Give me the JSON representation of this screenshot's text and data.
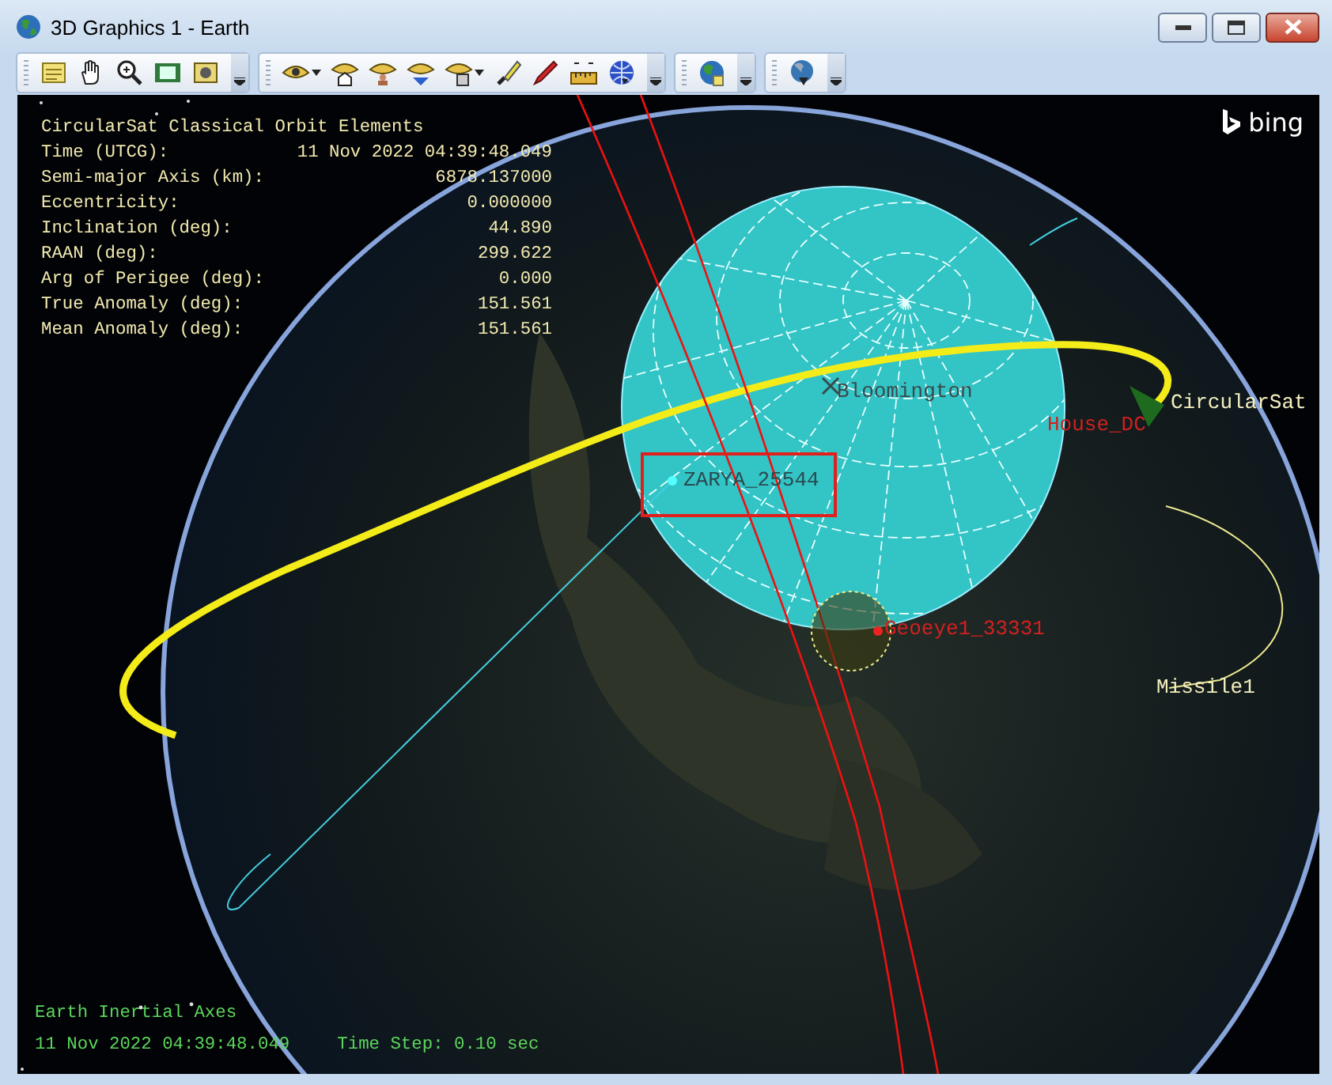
{
  "window": {
    "title": "3D Graphics 1 - Earth"
  },
  "orbit_elements": {
    "title": "CircularSat Classical Orbit Elements",
    "rows": [
      {
        "label": "Time (UTCG):",
        "value": "11 Nov 2022 04:39:48.049"
      },
      {
        "label": "Semi-major Axis (km):",
        "value": "6878.137000"
      },
      {
        "label": "Eccentricity:",
        "value": "0.000000"
      },
      {
        "label": "Inclination (deg):",
        "value": "44.890"
      },
      {
        "label": "RAAN (deg):",
        "value": "299.622"
      },
      {
        "label": "Arg of Perigee (deg):",
        "value": "0.000"
      },
      {
        "label": "True Anomaly (deg):",
        "value": "151.561"
      },
      {
        "label": "Mean Anomaly (deg):",
        "value": "151.561"
      }
    ]
  },
  "logo": {
    "label": "bing"
  },
  "objects": [
    {
      "label": "Bloomington",
      "color": "#3a4a4c",
      "highlighted": false
    },
    {
      "label": "House_DC",
      "color": "#d02020",
      "highlighted": false
    },
    {
      "label": "CircularSat",
      "color": "#f4f0c0",
      "highlighted": false
    },
    {
      "label": "ZARYA_25544",
      "color": "#2a4a4e",
      "highlighted": true
    },
    {
      "label": "Geoeye1_33331",
      "color": "#d42020",
      "highlighted": false
    },
    {
      "label": "Missile1",
      "color": "#f4f0c0",
      "highlighted": false
    }
  ],
  "footer": {
    "frame": "Earth Inertial Axes",
    "time": "11 Nov 2022 04:39:48.049",
    "time_step": "Time Step: 0.10 sec"
  }
}
